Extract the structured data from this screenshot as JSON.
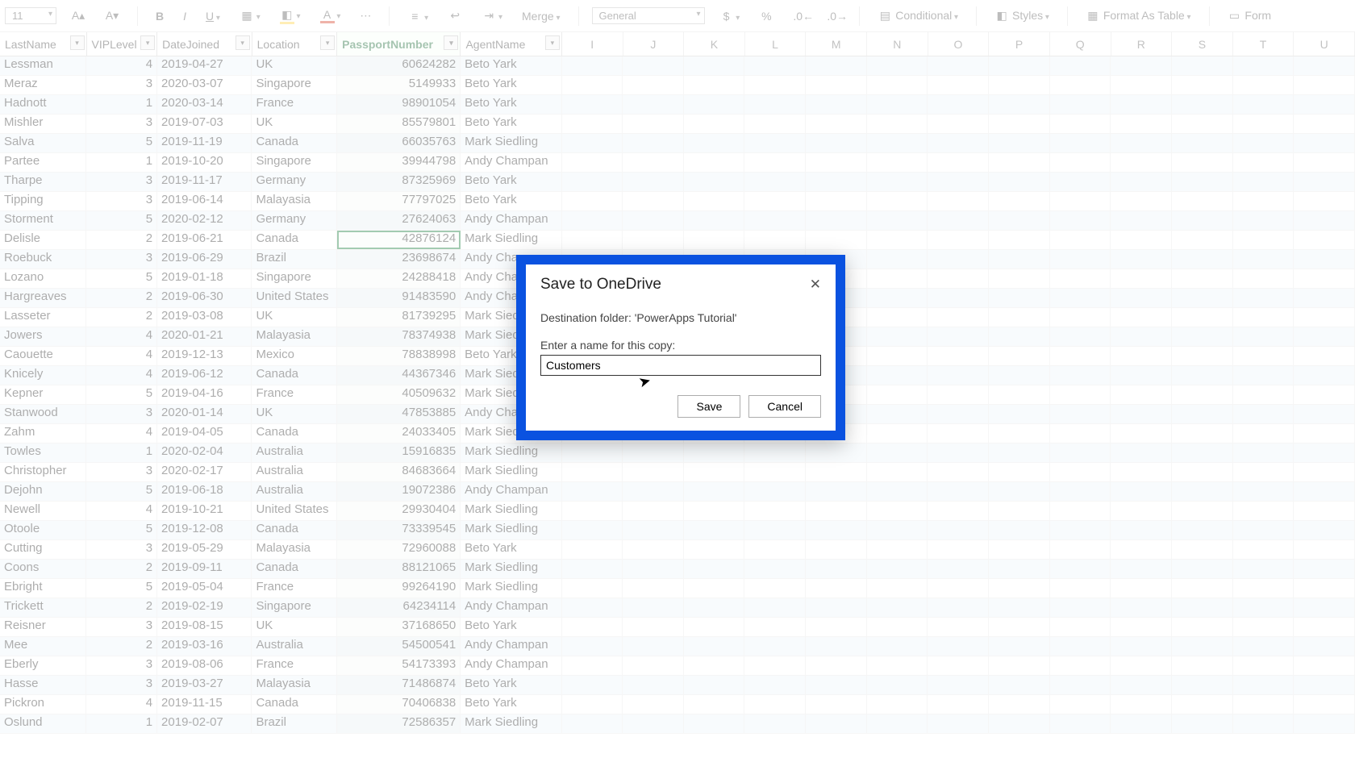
{
  "ribbon": {
    "font_size": "11",
    "number_format": "General",
    "merge_label": "Merge",
    "conditional_label": "Conditional",
    "styles_label": "Styles",
    "format_table_label": "Format As Table",
    "form_label": "Form"
  },
  "headers": [
    {
      "label": "LastName",
      "sorted": false
    },
    {
      "label": "VIPLevel",
      "sorted": false
    },
    {
      "label": "DateJoined",
      "sorted": false
    },
    {
      "label": "Location",
      "sorted": false
    },
    {
      "label": "PassportNumber",
      "sorted": true
    },
    {
      "label": "AgentName",
      "sorted": false
    }
  ],
  "letter_cols": [
    "I",
    "J",
    "K",
    "L",
    "M",
    "N",
    "O",
    "P",
    "Q",
    "R",
    "S",
    "T",
    "U"
  ],
  "rows": [
    {
      "last": "Lessman",
      "vip": 4,
      "date": "2019-04-27",
      "loc": "UK",
      "pass": "60624282",
      "agent": "Beto Yark"
    },
    {
      "last": "Meraz",
      "vip": 3,
      "date": "2020-03-07",
      "loc": "Singapore",
      "pass": "5149933",
      "agent": "Beto Yark"
    },
    {
      "last": "Hadnott",
      "vip": 1,
      "date": "2020-03-14",
      "loc": "France",
      "pass": "98901054",
      "agent": "Beto Yark"
    },
    {
      "last": "Mishler",
      "vip": 3,
      "date": "2019-07-03",
      "loc": "UK",
      "pass": "85579801",
      "agent": "Beto Yark"
    },
    {
      "last": "Salva",
      "vip": 5,
      "date": "2019-11-19",
      "loc": "Canada",
      "pass": "66035763",
      "agent": "Mark Siedling"
    },
    {
      "last": "Partee",
      "vip": 1,
      "date": "2019-10-20",
      "loc": "Singapore",
      "pass": "39944798",
      "agent": "Andy Champan"
    },
    {
      "last": "Tharpe",
      "vip": 3,
      "date": "2019-11-17",
      "loc": "Germany",
      "pass": "87325969",
      "agent": "Beto Yark"
    },
    {
      "last": "Tipping",
      "vip": 3,
      "date": "2019-06-14",
      "loc": "Malayasia",
      "pass": "77797025",
      "agent": "Beto Yark"
    },
    {
      "last": "Storment",
      "vip": 5,
      "date": "2020-02-12",
      "loc": "Germany",
      "pass": "27624063",
      "agent": "Andy Champan"
    },
    {
      "last": "Delisle",
      "vip": 2,
      "date": "2019-06-21",
      "loc": "Canada",
      "pass": "42876124",
      "agent": "Mark Siedling"
    },
    {
      "last": "Roebuck",
      "vip": 3,
      "date": "2019-06-29",
      "loc": "Brazil",
      "pass": "23698674",
      "agent": "Andy Champan"
    },
    {
      "last": "Lozano",
      "vip": 5,
      "date": "2019-01-18",
      "loc": "Singapore",
      "pass": "24288418",
      "agent": "Andy Champan"
    },
    {
      "last": "Hargreaves",
      "vip": 2,
      "date": "2019-06-30",
      "loc": "United States",
      "pass": "91483590",
      "agent": "Andy Champan"
    },
    {
      "last": "Lasseter",
      "vip": 2,
      "date": "2019-03-08",
      "loc": "UK",
      "pass": "81739295",
      "agent": "Mark Siedling"
    },
    {
      "last": "Jowers",
      "vip": 4,
      "date": "2020-01-21",
      "loc": "Malayasia",
      "pass": "78374938",
      "agent": "Mark Siedling"
    },
    {
      "last": "Caouette",
      "vip": 4,
      "date": "2019-12-13",
      "loc": "Mexico",
      "pass": "78838998",
      "agent": "Beto Yark"
    },
    {
      "last": "Knicely",
      "vip": 4,
      "date": "2019-06-12",
      "loc": "Canada",
      "pass": "44367346",
      "agent": "Mark Siedling"
    },
    {
      "last": "Kepner",
      "vip": 5,
      "date": "2019-04-16",
      "loc": "France",
      "pass": "40509632",
      "agent": "Mark Siedling"
    },
    {
      "last": "Stanwood",
      "vip": 3,
      "date": "2020-01-14",
      "loc": "UK",
      "pass": "47853885",
      "agent": "Andy Champan"
    },
    {
      "last": "Zahm",
      "vip": 4,
      "date": "2019-04-05",
      "loc": "Canada",
      "pass": "24033405",
      "agent": "Mark Siedling"
    },
    {
      "last": "Towles",
      "vip": 1,
      "date": "2020-02-04",
      "loc": "Australia",
      "pass": "15916835",
      "agent": "Mark Siedling"
    },
    {
      "last": "Christopher",
      "vip": 3,
      "date": "2020-02-17",
      "loc": "Australia",
      "pass": "84683664",
      "agent": "Mark Siedling"
    },
    {
      "last": "Dejohn",
      "vip": 5,
      "date": "2019-06-18",
      "loc": "Australia",
      "pass": "19072386",
      "agent": "Andy Champan"
    },
    {
      "last": "Newell",
      "vip": 4,
      "date": "2019-10-21",
      "loc": "United States",
      "pass": "29930404",
      "agent": "Mark Siedling"
    },
    {
      "last": "Otoole",
      "vip": 5,
      "date": "2019-12-08",
      "loc": "Canada",
      "pass": "73339545",
      "agent": "Mark Siedling"
    },
    {
      "last": "Cutting",
      "vip": 3,
      "date": "2019-05-29",
      "loc": "Malayasia",
      "pass": "72960088",
      "agent": "Beto Yark"
    },
    {
      "last": "Coons",
      "vip": 2,
      "date": "2019-09-11",
      "loc": "Canada",
      "pass": "88121065",
      "agent": "Mark Siedling"
    },
    {
      "last": "Ebright",
      "vip": 5,
      "date": "2019-05-04",
      "loc": "France",
      "pass": "99264190",
      "agent": "Mark Siedling"
    },
    {
      "last": "Trickett",
      "vip": 2,
      "date": "2019-02-19",
      "loc": "Singapore",
      "pass": "64234114",
      "agent": "Andy Champan"
    },
    {
      "last": "Reisner",
      "vip": 3,
      "date": "2019-08-15",
      "loc": "UK",
      "pass": "37168650",
      "agent": "Beto Yark"
    },
    {
      "last": "Mee",
      "vip": 2,
      "date": "2019-03-16",
      "loc": "Australia",
      "pass": "54500541",
      "agent": "Andy Champan"
    },
    {
      "last": "Eberly",
      "vip": 3,
      "date": "2019-08-06",
      "loc": "France",
      "pass": "54173393",
      "agent": "Andy Champan"
    },
    {
      "last": "Hasse",
      "vip": 3,
      "date": "2019-03-27",
      "loc": "Malayasia",
      "pass": "71486874",
      "agent": "Beto Yark"
    },
    {
      "last": "Pickron",
      "vip": 4,
      "date": "2019-11-15",
      "loc": "Canada",
      "pass": "70406838",
      "agent": "Beto Yark"
    },
    {
      "last": "Oslund",
      "vip": 1,
      "date": "2019-02-07",
      "loc": "Brazil",
      "pass": "72586357",
      "agent": "Mark Siedling"
    }
  ],
  "selected_row_index": 9,
  "dialog": {
    "title": "Save to OneDrive",
    "dest_prefix": "Destination folder: ",
    "dest_folder": "'PowerApps Tutorial'",
    "prompt": "Enter a name for this copy:",
    "value": "Customers",
    "save_label": "Save",
    "cancel_label": "Cancel"
  }
}
